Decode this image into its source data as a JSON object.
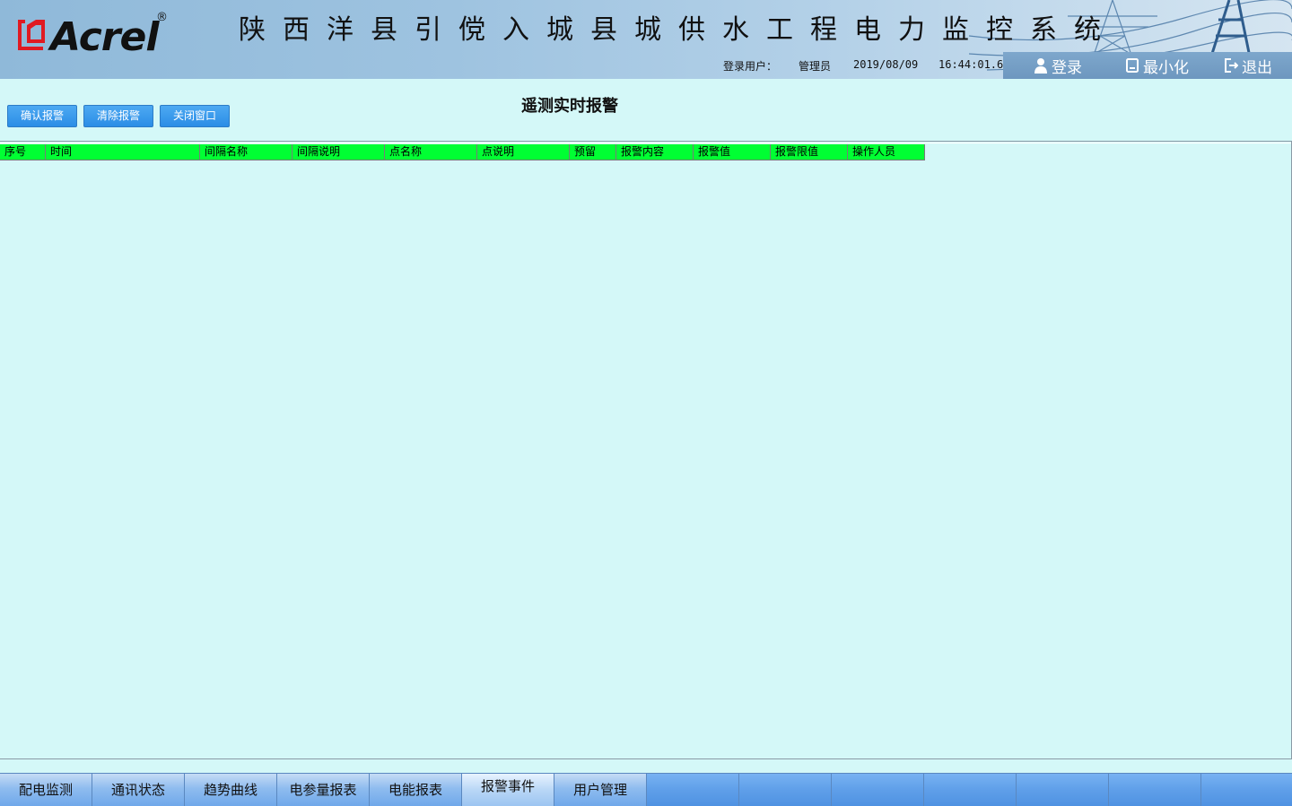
{
  "header": {
    "logo_text": "Acrel",
    "logo_reg": "®",
    "system_title": "陕西洋县引傥入城县城供水工程电力监控系统",
    "login_user_label": "登录用户：",
    "user_name": "管理员",
    "date": "2019/08/09",
    "time": "16:44:01.6",
    "login_label": "登录",
    "minimize_label": "最小化",
    "exit_label": "退出"
  },
  "toolbar": {
    "confirm_label": "确认报警",
    "clear_label": "清除报警",
    "close_label": "关闭窗口"
  },
  "page_title": "遥测实时报警",
  "table": {
    "columns": [
      "序号",
      "时间",
      "间隔名称",
      "间隔说明",
      "点名称",
      "点说明",
      "预留",
      "报警内容",
      "报警值",
      "报警限值",
      "操作人员"
    ],
    "rows": []
  },
  "tabs": {
    "items": [
      "配电监测",
      "通讯状态",
      "趋势曲线",
      "电参量报表",
      "电能报表",
      "报警事件",
      "用户管理",
      "",
      "",
      "",
      "",
      "",
      "",
      ""
    ],
    "active_index": 5
  },
  "colors": {
    "page_bg": "#d4f8f8",
    "column_header_bg": "#00ff33",
    "button_blue": "#2b8de6",
    "logo_red": "#e01a22"
  }
}
